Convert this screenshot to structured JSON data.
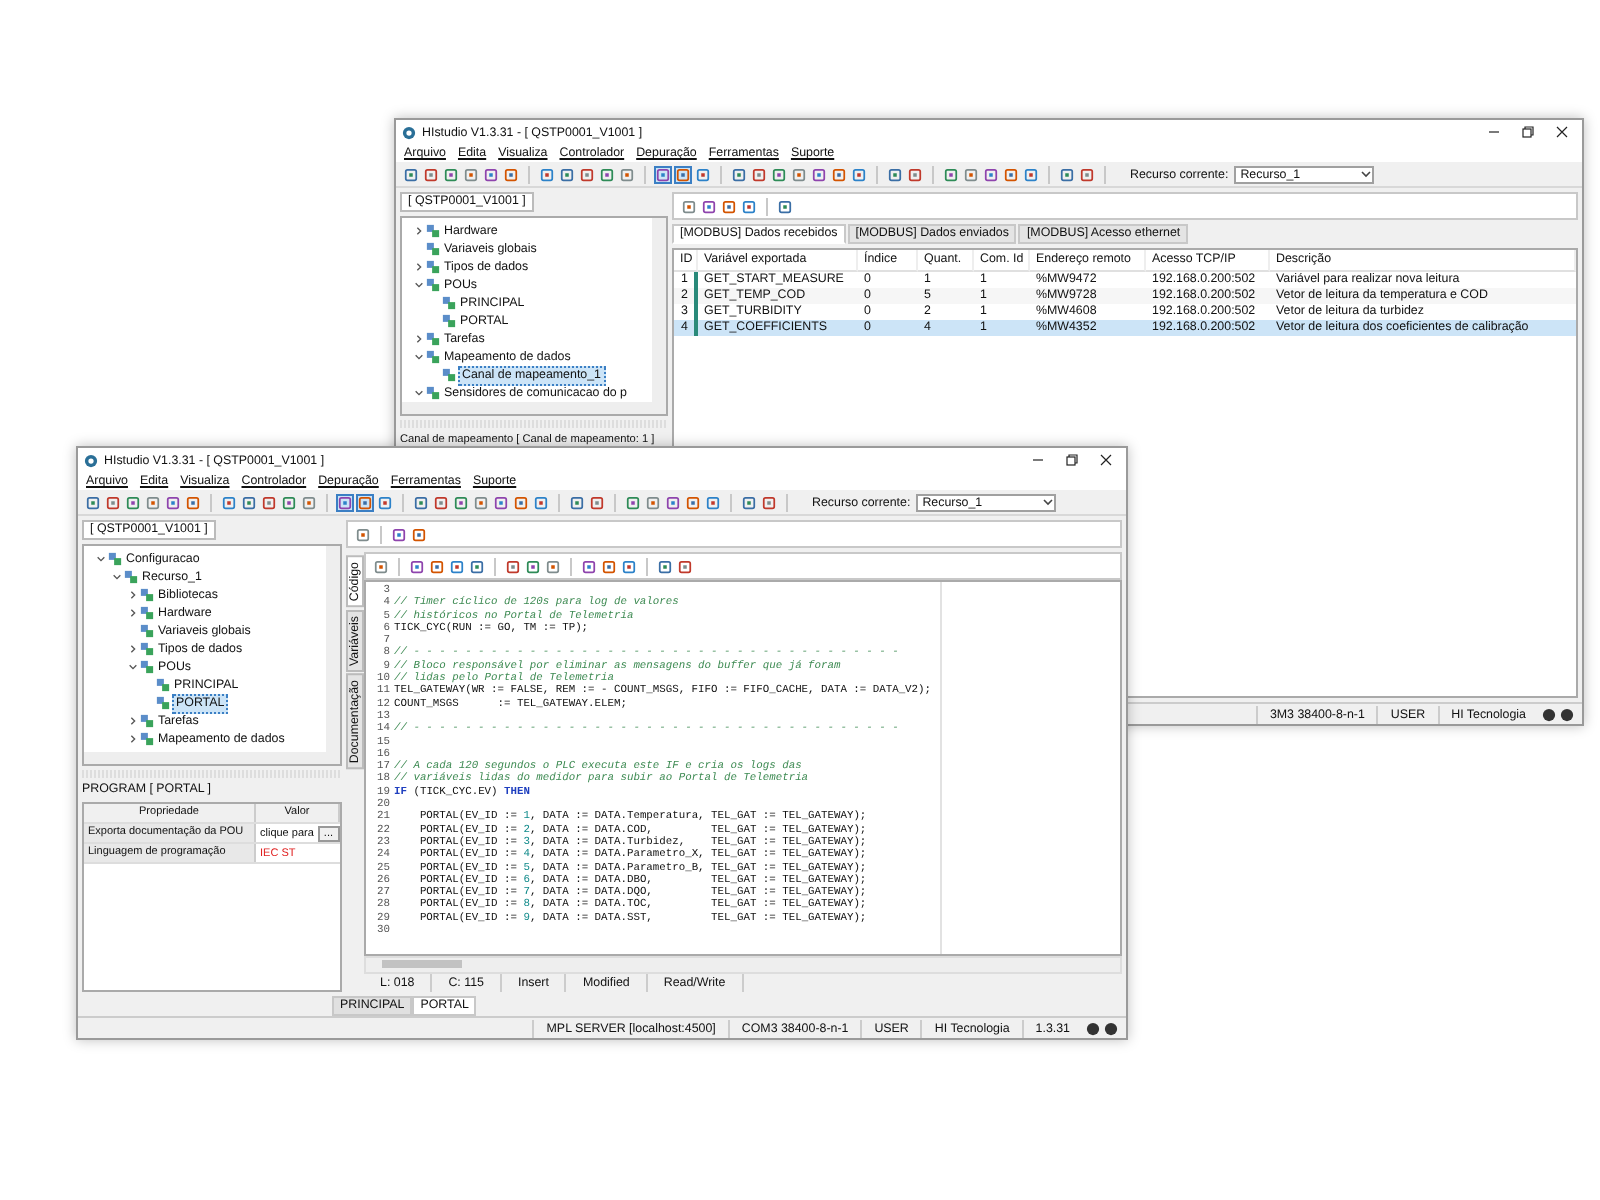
{
  "back_window": {
    "title": "HIstudio V1.3.31 - [ QSTP0001_V1001 ]",
    "menu": [
      "Arquivo",
      "Edita",
      "Visualiza",
      "Controlador",
      "Depuração",
      "Ferramentas",
      "Suporte"
    ],
    "toolbar": {
      "groups": [
        {
          "buttons": [
            {
              "pressed": false
            },
            {
              "pressed": false
            },
            {
              "pressed": false
            },
            {
              "pressed": false
            },
            {
              "pressed": false
            },
            {
              "pressed": false
            }
          ]
        },
        {
          "buttons": [
            {
              "pressed": false
            },
            {
              "pressed": false
            },
            {
              "pressed": false
            },
            {
              "pressed": false
            },
            {
              "pressed": false
            }
          ]
        },
        {
          "buttons": [
            {
              "pressed": true
            },
            {
              "pressed": true
            },
            {
              "pressed": false
            }
          ]
        },
        {
          "buttons": [
            {
              "pressed": false
            },
            {
              "pressed": false
            },
            {
              "pressed": false
            },
            {
              "pressed": false
            },
            {
              "pressed": false
            },
            {
              "pressed": false
            },
            {
              "pressed": false
            }
          ]
        },
        {
          "buttons": [
            {
              "pressed": false
            },
            {
              "pressed": false
            }
          ]
        },
        {
          "buttons": [
            {
              "pressed": false
            },
            {
              "pressed": false
            },
            {
              "pressed": false
            },
            {
              "pressed": false
            },
            {
              "pressed": false
            }
          ]
        },
        {
          "buttons": [
            {
              "pressed": false
            },
            {
              "pressed": false
            }
          ]
        }
      ],
      "resource_label": "Recurso corrente:",
      "resource_value": "Recurso_1"
    },
    "project_tab": "[ QSTP0001_V1001 ]",
    "tree": [
      {
        "label": "Hardware",
        "selected": false,
        "expanded": false
      },
      {
        "label": "Variaveis globais",
        "selected": false
      },
      {
        "label": "Tipos de dados",
        "selected": false,
        "expanded": false
      },
      {
        "label": "POUs",
        "selected": false,
        "expanded": true,
        "children": [
          {
            "label": "PRINCIPAL",
            "selected": false
          },
          {
            "label": "PORTAL",
            "selected": false
          }
        ]
      },
      {
        "label": "Tarefas",
        "selected": false,
        "expanded": false
      },
      {
        "label": "Mapeamento de dados",
        "selected": false,
        "expanded": true,
        "children": [
          {
            "label": "Canal de mapeamento_1",
            "selected": true
          }
        ]
      },
      {
        "label": "Sensidores de comunicacao do p",
        "selected": false,
        "expanded": true
      }
    ],
    "panel_title": "Canal de mapeamento [ Canal de mapeamento: 1 ]",
    "mapping_tabs": [
      {
        "label": "[MODBUS] Dados recebidos",
        "selected": true
      },
      {
        "label": "[MODBUS] Dados enviados",
        "selected": false
      },
      {
        "label": "[MODBUS] Acesso ethernet",
        "selected": false
      }
    ],
    "table": {
      "columns": [
        "ID",
        "Variável exportada",
        "Índice",
        "Quant.",
        "Com. Id",
        "Endereço remoto",
        "Acesso TCP/IP",
        "Descrição"
      ],
      "rows": [
        {
          "selected": false,
          "cells": [
            "1",
            "GET_START_MEASURE",
            "0",
            "1",
            "1",
            "%MW9472",
            "192.168.0.200:502",
            "Variável para realizar nova leitura"
          ]
        },
        {
          "selected": false,
          "cells": [
            "2",
            "GET_TEMP_COD",
            "0",
            "5",
            "1",
            "%MW9728",
            "192.168.0.200:502",
            "Vetor de leitura da temperatura e COD"
          ]
        },
        {
          "selected": false,
          "cells": [
            "3",
            "GET_TURBIDITY",
            "0",
            "2",
            "1",
            "%MW4608",
            "192.168.0.200:502",
            "Vetor de leitura da turbidez"
          ]
        },
        {
          "selected": true,
          "cells": [
            "4",
            "GET_COEFFICIENTS",
            "0",
            "4",
            "1",
            "%MW4352",
            "192.168.0.200:502",
            "Vetor de leitura dos coeficientes de calibração"
          ]
        }
      ]
    },
    "status_bar": [
      "3M3 38400-8-n-1",
      "USER",
      "HI Tecnologia"
    ]
  },
  "front_window": {
    "title": "HIstudio V1.3.31 - [ QSTP0001_V1001 ]",
    "menu": [
      "Arquivo",
      "Edita",
      "Visualiza",
      "Controlador",
      "Depuração",
      "Ferramentas",
      "Suporte"
    ],
    "toolbar": {
      "groups": [
        {
          "buttons": [
            {
              "pressed": false
            },
            {
              "pressed": false
            },
            {
              "pressed": false
            },
            {
              "pressed": false
            },
            {
              "pressed": false
            },
            {
              "pressed": false
            }
          ]
        },
        {
          "buttons": [
            {
              "pressed": false
            },
            {
              "pressed": false
            },
            {
              "pressed": false
            },
            {
              "pressed": false
            },
            {
              "pressed": false
            }
          ]
        },
        {
          "buttons": [
            {
              "pressed": true
            },
            {
              "pressed": true
            },
            {
              "pressed": false
            }
          ]
        },
        {
          "buttons": [
            {
              "pressed": false
            },
            {
              "pressed": false
            },
            {
              "pressed": false
            },
            {
              "pressed": false
            },
            {
              "pressed": false
            },
            {
              "pressed": false
            },
            {
              "pressed": false
            }
          ]
        },
        {
          "buttons": [
            {
              "pressed": false
            },
            {
              "pressed": false
            }
          ]
        },
        {
          "buttons": [
            {
              "pressed": false
            },
            {
              "pressed": false
            },
            {
              "pressed": false
            },
            {
              "pressed": false
            },
            {
              "pressed": false
            }
          ]
        },
        {
          "buttons": [
            {
              "pressed": false
            },
            {
              "pressed": false
            }
          ]
        }
      ],
      "resource_label": "Recurso corrente:",
      "resource_value": "Recurso_1"
    },
    "project_tab": "[ QSTP0001_V1001 ]",
    "tree": [
      {
        "label": "Configuracao",
        "selected": false,
        "expanded": true,
        "children": [
          {
            "label": "Recurso_1",
            "selected": false,
            "expanded": true,
            "children": [
              {
                "label": "Bibliotecas",
                "selected": false,
                "expanded": false
              },
              {
                "label": "Hardware",
                "selected": false,
                "expanded": false
              },
              {
                "label": "Variaveis globais",
                "selected": false
              },
              {
                "label": "Tipos de dados",
                "selected": false,
                "expanded": false
              },
              {
                "label": "POUs",
                "selected": false,
                "expanded": true,
                "children": [
                  {
                    "label": "PRINCIPAL",
                    "selected": false
                  },
                  {
                    "label": "PORTAL",
                    "selected": true
                  }
                ]
              },
              {
                "label": "Tarefas",
                "selected": false,
                "expanded": false
              },
              {
                "label": "Mapeamento de dados",
                "selected": false,
                "expanded": false
              }
            ]
          }
        ]
      }
    ],
    "properties": {
      "title": "PROGRAM [ PORTAL ]",
      "columns": [
        "Propriedade",
        "Valor"
      ],
      "rows": [
        {
          "kind": "action",
          "name": "Exporta documentação da POU",
          "value": "clique para",
          "button": "..."
        },
        {
          "kind": "language",
          "name": "Linguagem de programação",
          "value": "IEC ST"
        }
      ]
    },
    "side_tabs": [
      {
        "label": "Código",
        "selected": true
      },
      {
        "label": "Variáveis",
        "selected": false
      },
      {
        "label": "Documentação",
        "selected": false
      }
    ],
    "editor": {
      "lines": [
        {
          "number": "3"
        },
        {
          "number": "4",
          "segments": [
            {
              "kind": "comment",
              "text": "// Timer cíclico de 120s para log de valores"
            }
          ]
        },
        {
          "number": "5",
          "segments": [
            {
              "kind": "comment",
              "text": "// históricos no Portal de Telemetria"
            }
          ]
        },
        {
          "number": "6",
          "segments": [
            {
              "kind": "code",
              "text": "TICK_CYC(RUN := GO, TM := TP);"
            }
          ]
        },
        {
          "number": "7"
        },
        {
          "number": "8",
          "segments": [
            {
              "kind": "comment",
              "text": "// - - - - - - - - - - - - - - - - - - - - - - - - - - - - - - - - - - - - - -"
            }
          ]
        },
        {
          "number": "9",
          "segments": [
            {
              "kind": "comment",
              "text": "// Bloco responsável por eliminar as mensagens do buffer que já foram"
            }
          ]
        },
        {
          "number": "10",
          "segments": [
            {
              "kind": "comment",
              "text": "// lidas pelo Portal de Telemetria"
            }
          ]
        },
        {
          "number": "11",
          "segments": [
            {
              "kind": "code",
              "text": "TEL_GATEWAY(WR := FALSE, REM := - COUNT_MSGS, FIFO := FIFO_CACHE, DATA := DATA_V2);"
            }
          ]
        },
        {
          "number": "12",
          "segments": [
            {
              "kind": "code",
              "text": "COUNT_MSGS      := TEL_GATEWAY.ELEM;"
            }
          ]
        },
        {
          "number": "13"
        },
        {
          "number": "14",
          "segments": [
            {
              "kind": "comment",
              "text": "// - - - - - - - - - - - - - - - - - - - - - - - - - - - - - - - - - - - - - -"
            }
          ]
        },
        {
          "number": "15"
        },
        {
          "number": "16"
        },
        {
          "number": "17",
          "segments": [
            {
              "kind": "comment",
              "text": "// A cada 120 segundos o PLC executa este IF e cria os logs das"
            }
          ]
        },
        {
          "number": "18",
          "segments": [
            {
              "kind": "comment",
              "text": "// variáveis lidas do medidor para subir ao Portal de Telemetria"
            }
          ]
        },
        {
          "number": "19",
          "segments": [
            {
              "kind": "keyword",
              "text": "IF"
            },
            {
              "kind": "code",
              "text": " (TICK_CYC.EV) "
            },
            {
              "kind": "keyword",
              "text": "THEN"
            }
          ]
        },
        {
          "number": "20"
        },
        {
          "number": "21",
          "segments": [
            {
              "kind": "code",
              "text": "    PORTAL(EV_ID := "
            },
            {
              "kind": "number",
              "text": "1"
            },
            {
              "kind": "code",
              "text": ", DATA := DATA.Temperatura, TEL_GAT := TEL_GATEWAY);"
            }
          ]
        },
        {
          "number": "22",
          "segments": [
            {
              "kind": "code",
              "text": "    PORTAL(EV_ID := "
            },
            {
              "kind": "number",
              "text": "2"
            },
            {
              "kind": "code",
              "text": ", DATA := DATA.COD,         TEL_GAT := TEL_GATEWAY);"
            }
          ]
        },
        {
          "number": "23",
          "segments": [
            {
              "kind": "code",
              "text": "    PORTAL(EV_ID := "
            },
            {
              "kind": "number",
              "text": "3"
            },
            {
              "kind": "code",
              "text": ", DATA := DATA.Turbidez,    TEL_GAT := TEL_GATEWAY);"
            }
          ]
        },
        {
          "number": "24",
          "segments": [
            {
              "kind": "code",
              "text": "    PORTAL(EV_ID := "
            },
            {
              "kind": "number",
              "text": "4"
            },
            {
              "kind": "code",
              "text": ", DATA := DATA.Parametro_X, TEL_GAT := TEL_GATEWAY);"
            }
          ]
        },
        {
          "number": "25",
          "segments": [
            {
              "kind": "code",
              "text": "    PORTAL(EV_ID := "
            },
            {
              "kind": "number",
              "text": "5"
            },
            {
              "kind": "code",
              "text": ", DATA := DATA.Parametro_B, TEL_GAT := TEL_GATEWAY);"
            }
          ]
        },
        {
          "number": "26",
          "segments": [
            {
              "kind": "code",
              "text": "    PORTAL(EV_ID := "
            },
            {
              "kind": "number",
              "text": "6"
            },
            {
              "kind": "code",
              "text": ", DATA := DATA.DBO,         TEL_GAT := TEL_GATEWAY);"
            }
          ]
        },
        {
          "number": "27",
          "segments": [
            {
              "kind": "code",
              "text": "    PORTAL(EV_ID := "
            },
            {
              "kind": "number",
              "text": "7"
            },
            {
              "kind": "code",
              "text": ", DATA := DATA.DQO,         TEL_GAT := TEL_GATEWAY);"
            }
          ]
        },
        {
          "number": "28",
          "segments": [
            {
              "kind": "code",
              "text": "    PORTAL(EV_ID := "
            },
            {
              "kind": "number",
              "text": "8"
            },
            {
              "kind": "code",
              "text": ", DATA := DATA.TOC,         TEL_GAT := TEL_GATEWAY);"
            }
          ]
        },
        {
          "number": "29",
          "segments": [
            {
              "kind": "code",
              "text": "    PORTAL(EV_ID := "
            },
            {
              "kind": "number",
              "text": "9"
            },
            {
              "kind": "code",
              "text": ", DATA := DATA.SST,         TEL_GAT := TEL_GATEWAY);"
            }
          ]
        },
        {
          "number": "30"
        }
      ]
    },
    "cursor_status": [
      "L: 018",
      "C: 115",
      "Insert",
      "Modified",
      "Read/Write"
    ],
    "pou_tabs": [
      {
        "label": "PRINCIPAL",
        "selected": false
      },
      {
        "label": "PORTAL",
        "selected": true
      }
    ],
    "status_bar": [
      "MPL SERVER [localhost:4500]",
      "COM3 38400-8-n-1",
      "USER",
      "HI Tecnologia",
      "1.3.31"
    ]
  }
}
